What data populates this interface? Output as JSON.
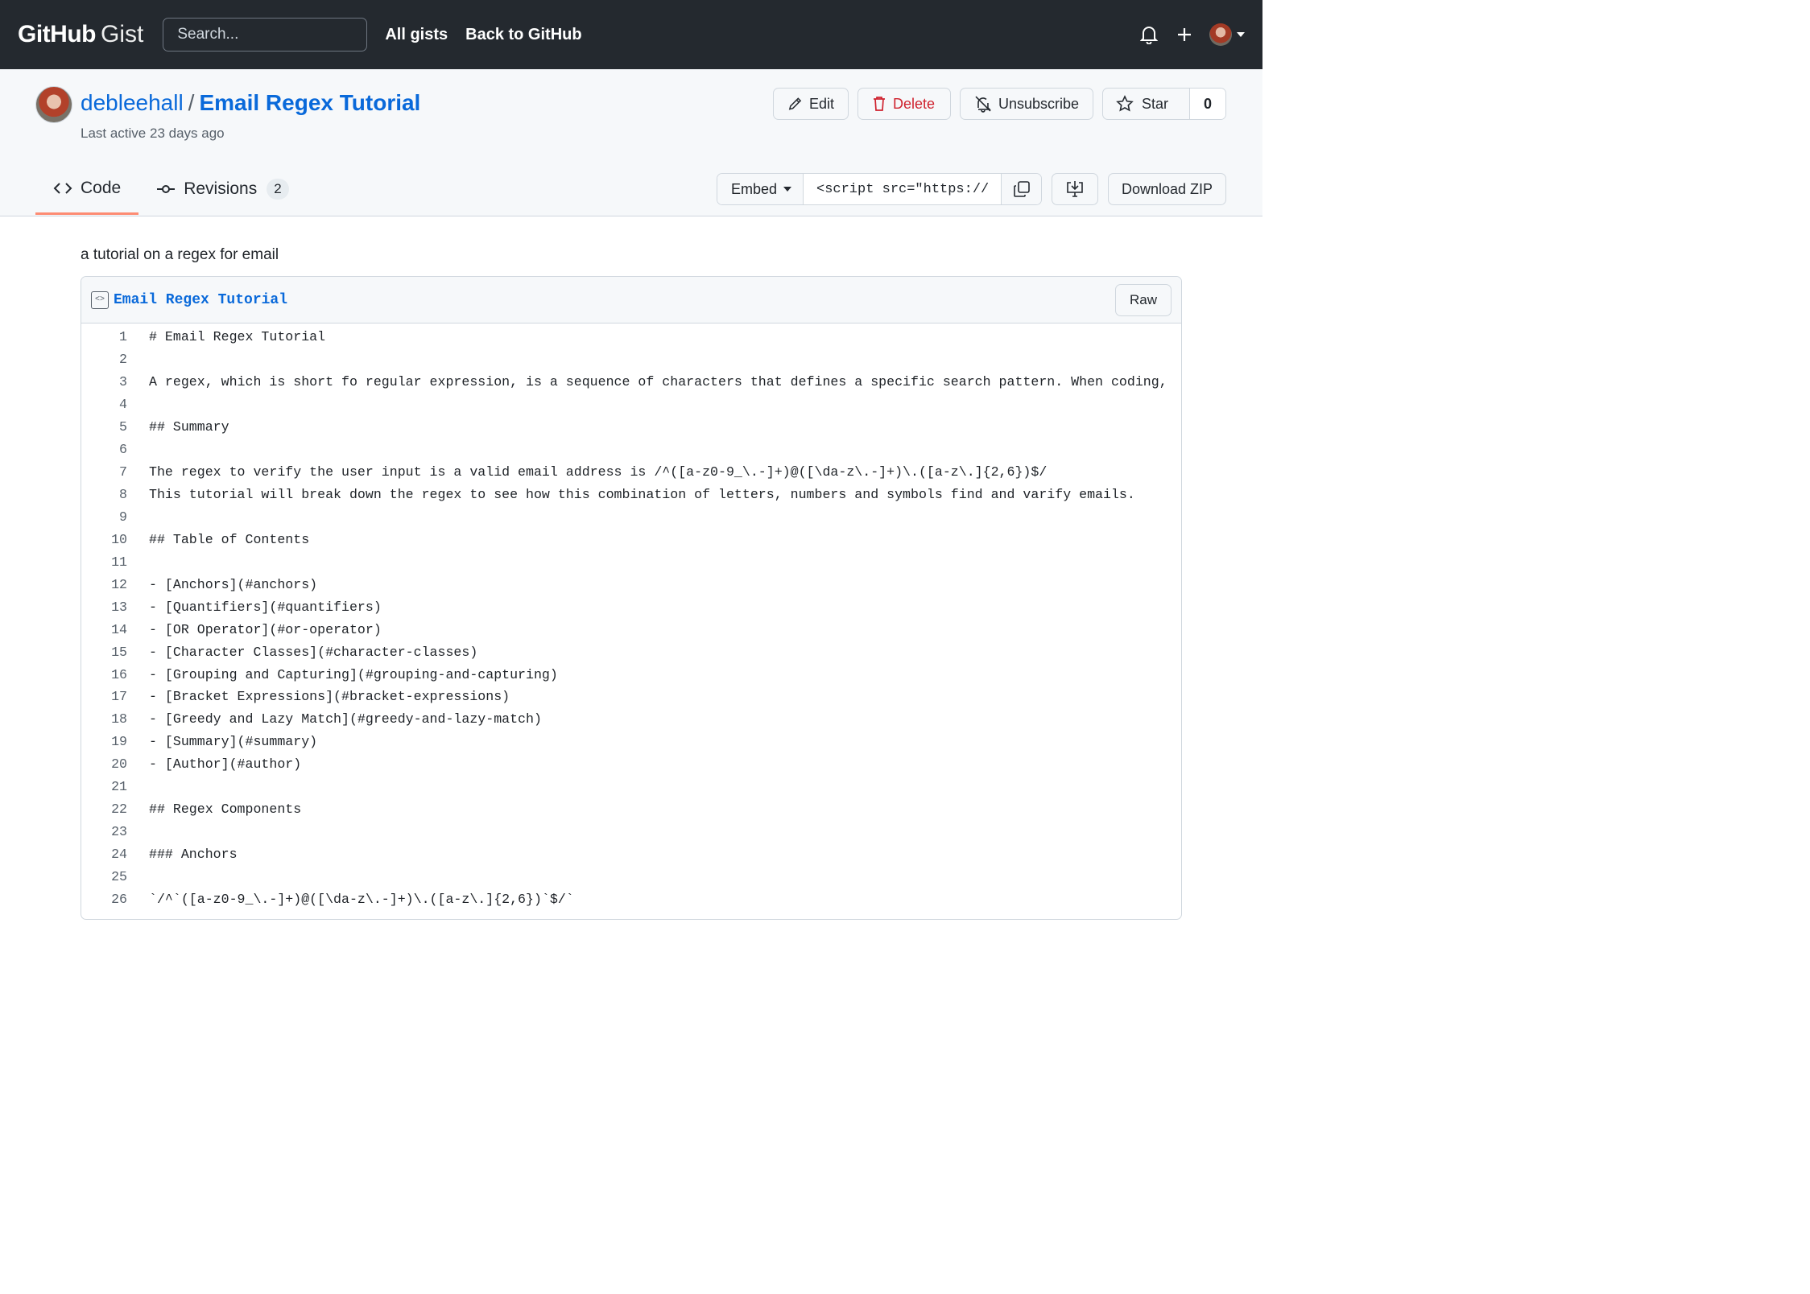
{
  "header": {
    "logo_main": "GitHub",
    "logo_sub": "Gist",
    "search_placeholder": "Search...",
    "nav": [
      "All gists",
      "Back to GitHub"
    ]
  },
  "gist": {
    "owner": "debleehall",
    "separator": "/",
    "name": "Email Regex Tutorial",
    "last_active": "Last active 23 days ago",
    "actions": {
      "edit": "Edit",
      "delete": "Delete",
      "unsubscribe": "Unsubscribe",
      "star": "Star",
      "star_count": "0"
    },
    "tabs": [
      {
        "label": "Code",
        "active": true
      },
      {
        "label": "Revisions",
        "count": "2",
        "active": false
      }
    ],
    "embed": {
      "label": "Embed",
      "value": "<script src=\"https://"
    },
    "download_zip": "Download ZIP",
    "description": "a tutorial on a regex for email"
  },
  "file": {
    "name": "Email Regex Tutorial",
    "raw_label": "Raw",
    "lines": [
      "# Email Regex Tutorial",
      "",
      "A regex, which is short fo regular expression, is a sequence of characters that defines a specific search pattern. When coding,",
      "",
      "## Summary",
      "",
      "The regex to verify the user input is a valid email address is /^([a-z0-9_\\.-]+)@([\\da-z\\.-]+)\\.([a-z\\.]{2,6})$/",
      "This tutorial will break down the regex to see how this combination of letters, numbers and symbols find and varify emails.",
      "",
      "## Table of Contents",
      "",
      "- [Anchors](#anchors)",
      "- [Quantifiers](#quantifiers)",
      "- [OR Operator](#or-operator)",
      "- [Character Classes](#character-classes)",
      "- [Grouping and Capturing](#grouping-and-capturing)",
      "- [Bracket Expressions](#bracket-expressions)",
      "- [Greedy and Lazy Match](#greedy-and-lazy-match)",
      "- [Summary](#summary)",
      "- [Author](#author)",
      "",
      "## Regex Components",
      "",
      "### Anchors",
      "",
      "`/^`([a-z0-9_\\.-]+)@([\\da-z\\.-]+)\\.([a-z\\.]{2,6})`$/`"
    ]
  },
  "colors": {
    "header_bg": "#24292f",
    "link": "#0969da",
    "danger": "#cf222e",
    "tab_active_underline": "#fd8c73"
  }
}
